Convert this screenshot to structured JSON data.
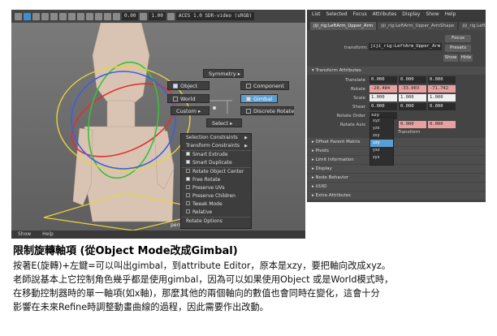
{
  "viewport": {
    "toolbar": {
      "field1": "0.00",
      "field2": "1.00",
      "colorspace": "ACES 1.0 SDR-video (sRGB)"
    },
    "camera_label": "persp",
    "status": {
      "show": "Show",
      "help": "Help"
    },
    "marking_menu": {
      "symmetry": "Symmetry",
      "object": "Object",
      "component": "Component",
      "world": "World",
      "gimbal": "Gimbal",
      "custom": "Custom",
      "discrete_rotate": "Discrete Rotate",
      "select": "Select"
    },
    "popup_items": [
      {
        "label": "Selection Constraints",
        "check": "none",
        "arrow": true
      },
      {
        "label": "Transform Constraints",
        "check": "none",
        "arrow": true
      },
      {
        "label": "Smart Extrude",
        "check": "on",
        "arrow": false
      },
      {
        "label": "Smart Duplicate",
        "check": "on",
        "arrow": false
      },
      {
        "label": "Rotate Object Center",
        "check": "off",
        "arrow": false
      },
      {
        "label": "Free Rotate",
        "check": "on",
        "arrow": false
      },
      {
        "label": "Preserve UVs",
        "check": "off",
        "arrow": false
      },
      {
        "label": "Preserve Children",
        "check": "off",
        "arrow": false
      },
      {
        "label": "Tweak Mode",
        "check": "off",
        "arrow": false
      },
      {
        "label": "Relative",
        "check": "off",
        "arrow": false
      },
      {
        "label": "Rotate Options",
        "check": "none",
        "arrow": false
      }
    ]
  },
  "attribute_editor": {
    "menu": [
      "List",
      "Selected",
      "Focus",
      "Attributes",
      "Display",
      "Show",
      "Help"
    ],
    "tabs": [
      "jiji_rig:LeftArm_Upper_Arm",
      "jiji_rig:LeftArm_Upper_ArmShape",
      "jiji_rig:LeftA"
    ],
    "transform_label": "transform:",
    "transform_value": "jiji_rig:LeftArm_Upper_Arm",
    "focus": "Focus",
    "presets": "Presets",
    "show": "Show",
    "hide": "Hide",
    "section_transform": "Transform Attributes",
    "rows": [
      {
        "label": "Translate",
        "values": [
          "0.000",
          "0.000",
          "0.000"
        ],
        "style": "dark"
      },
      {
        "label": "Rotate",
        "values": [
          "-28.484",
          "-33.003",
          "-71.742"
        ],
        "style": "red"
      },
      {
        "label": "Scale",
        "values": [
          "1.000",
          "1.000",
          "1.000"
        ],
        "style": "white"
      },
      {
        "label": "Shear",
        "values": [
          "0.000",
          "0.000",
          "0.000"
        ],
        "style": "dark"
      }
    ],
    "rotate_order_label": "Rotate Order",
    "rotate_order_value": "xzy",
    "rotate_axis_label": "Rotate Axis",
    "rotate_axis_values": [
      "0.000",
      "0.000"
    ],
    "rotate_order_options": [
      "xyz",
      "yzx",
      "zxy",
      "xzy",
      "yxz",
      "zyx"
    ],
    "rotate_order_selected_index": 3,
    "transform_suffix": "Transform",
    "sections": [
      "Offset Parent Matrix",
      "Pivots",
      "Limit Information",
      "Display",
      "Node Behavior",
      "UUID",
      "Extra Attributes"
    ]
  },
  "text": {
    "title": "限制旋轉軸項 (從Object Mode改成Gimbal)",
    "lines": [
      "按著E(旋轉)+左鍵=可以叫出gimbal，到attribute Editor，原本是xzy，要把軸向改成xyz。",
      "老師說基本上它控制角色幾乎都是使用gimbal，因為可以如果使用Object 或是World模式時，",
      "在移動控制器時的單一軸項(如x軸)，那麼其他的兩個軸向的數值也會同時在變化，這會十分",
      "影響在未來Refine時調整動畫曲線的過程，因此需要作出改動。"
    ]
  },
  "colors": {
    "highlight": "#5a9fd4",
    "panel": "#444444",
    "viewport_bg": "#6f6f6f"
  }
}
